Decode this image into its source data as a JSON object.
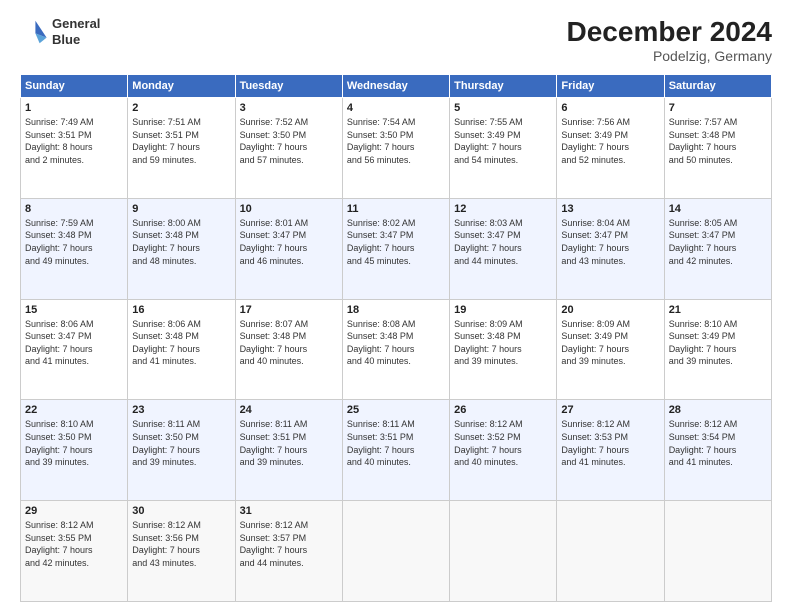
{
  "header": {
    "logo_line1": "General",
    "logo_line2": "Blue",
    "month": "December 2024",
    "location": "Podelzig, Germany"
  },
  "weekdays": [
    "Sunday",
    "Monday",
    "Tuesday",
    "Wednesday",
    "Thursday",
    "Friday",
    "Saturday"
  ],
  "weeks": [
    [
      {
        "day": "1",
        "info": "Sunrise: 7:49 AM\nSunset: 3:51 PM\nDaylight: 8 hours\nand 2 minutes."
      },
      {
        "day": "2",
        "info": "Sunrise: 7:51 AM\nSunset: 3:51 PM\nDaylight: 7 hours\nand 59 minutes."
      },
      {
        "day": "3",
        "info": "Sunrise: 7:52 AM\nSunset: 3:50 PM\nDaylight: 7 hours\nand 57 minutes."
      },
      {
        "day": "4",
        "info": "Sunrise: 7:54 AM\nSunset: 3:50 PM\nDaylight: 7 hours\nand 56 minutes."
      },
      {
        "day": "5",
        "info": "Sunrise: 7:55 AM\nSunset: 3:49 PM\nDaylight: 7 hours\nand 54 minutes."
      },
      {
        "day": "6",
        "info": "Sunrise: 7:56 AM\nSunset: 3:49 PM\nDaylight: 7 hours\nand 52 minutes."
      },
      {
        "day": "7",
        "info": "Sunrise: 7:57 AM\nSunset: 3:48 PM\nDaylight: 7 hours\nand 50 minutes."
      }
    ],
    [
      {
        "day": "8",
        "info": "Sunrise: 7:59 AM\nSunset: 3:48 PM\nDaylight: 7 hours\nand 49 minutes."
      },
      {
        "day": "9",
        "info": "Sunrise: 8:00 AM\nSunset: 3:48 PM\nDaylight: 7 hours\nand 48 minutes."
      },
      {
        "day": "10",
        "info": "Sunrise: 8:01 AM\nSunset: 3:47 PM\nDaylight: 7 hours\nand 46 minutes."
      },
      {
        "day": "11",
        "info": "Sunrise: 8:02 AM\nSunset: 3:47 PM\nDaylight: 7 hours\nand 45 minutes."
      },
      {
        "day": "12",
        "info": "Sunrise: 8:03 AM\nSunset: 3:47 PM\nDaylight: 7 hours\nand 44 minutes."
      },
      {
        "day": "13",
        "info": "Sunrise: 8:04 AM\nSunset: 3:47 PM\nDaylight: 7 hours\nand 43 minutes."
      },
      {
        "day": "14",
        "info": "Sunrise: 8:05 AM\nSunset: 3:47 PM\nDaylight: 7 hours\nand 42 minutes."
      }
    ],
    [
      {
        "day": "15",
        "info": "Sunrise: 8:06 AM\nSunset: 3:47 PM\nDaylight: 7 hours\nand 41 minutes."
      },
      {
        "day": "16",
        "info": "Sunrise: 8:06 AM\nSunset: 3:48 PM\nDaylight: 7 hours\nand 41 minutes."
      },
      {
        "day": "17",
        "info": "Sunrise: 8:07 AM\nSunset: 3:48 PM\nDaylight: 7 hours\nand 40 minutes."
      },
      {
        "day": "18",
        "info": "Sunrise: 8:08 AM\nSunset: 3:48 PM\nDaylight: 7 hours\nand 40 minutes."
      },
      {
        "day": "19",
        "info": "Sunrise: 8:09 AM\nSunset: 3:48 PM\nDaylight: 7 hours\nand 39 minutes."
      },
      {
        "day": "20",
        "info": "Sunrise: 8:09 AM\nSunset: 3:49 PM\nDaylight: 7 hours\nand 39 minutes."
      },
      {
        "day": "21",
        "info": "Sunrise: 8:10 AM\nSunset: 3:49 PM\nDaylight: 7 hours\nand 39 minutes."
      }
    ],
    [
      {
        "day": "22",
        "info": "Sunrise: 8:10 AM\nSunset: 3:50 PM\nDaylight: 7 hours\nand 39 minutes."
      },
      {
        "day": "23",
        "info": "Sunrise: 8:11 AM\nSunset: 3:50 PM\nDaylight: 7 hours\nand 39 minutes."
      },
      {
        "day": "24",
        "info": "Sunrise: 8:11 AM\nSunset: 3:51 PM\nDaylight: 7 hours\nand 39 minutes."
      },
      {
        "day": "25",
        "info": "Sunrise: 8:11 AM\nSunset: 3:51 PM\nDaylight: 7 hours\nand 40 minutes."
      },
      {
        "day": "26",
        "info": "Sunrise: 8:12 AM\nSunset: 3:52 PM\nDaylight: 7 hours\nand 40 minutes."
      },
      {
        "day": "27",
        "info": "Sunrise: 8:12 AM\nSunset: 3:53 PM\nDaylight: 7 hours\nand 41 minutes."
      },
      {
        "day": "28",
        "info": "Sunrise: 8:12 AM\nSunset: 3:54 PM\nDaylight: 7 hours\nand 41 minutes."
      }
    ],
    [
      {
        "day": "29",
        "info": "Sunrise: 8:12 AM\nSunset: 3:55 PM\nDaylight: 7 hours\nand 42 minutes."
      },
      {
        "day": "30",
        "info": "Sunrise: 8:12 AM\nSunset: 3:56 PM\nDaylight: 7 hours\nand 43 minutes."
      },
      {
        "day": "31",
        "info": "Sunrise: 8:12 AM\nSunset: 3:57 PM\nDaylight: 7 hours\nand 44 minutes."
      },
      {
        "day": "",
        "info": ""
      },
      {
        "day": "",
        "info": ""
      },
      {
        "day": "",
        "info": ""
      },
      {
        "day": "",
        "info": ""
      }
    ]
  ]
}
